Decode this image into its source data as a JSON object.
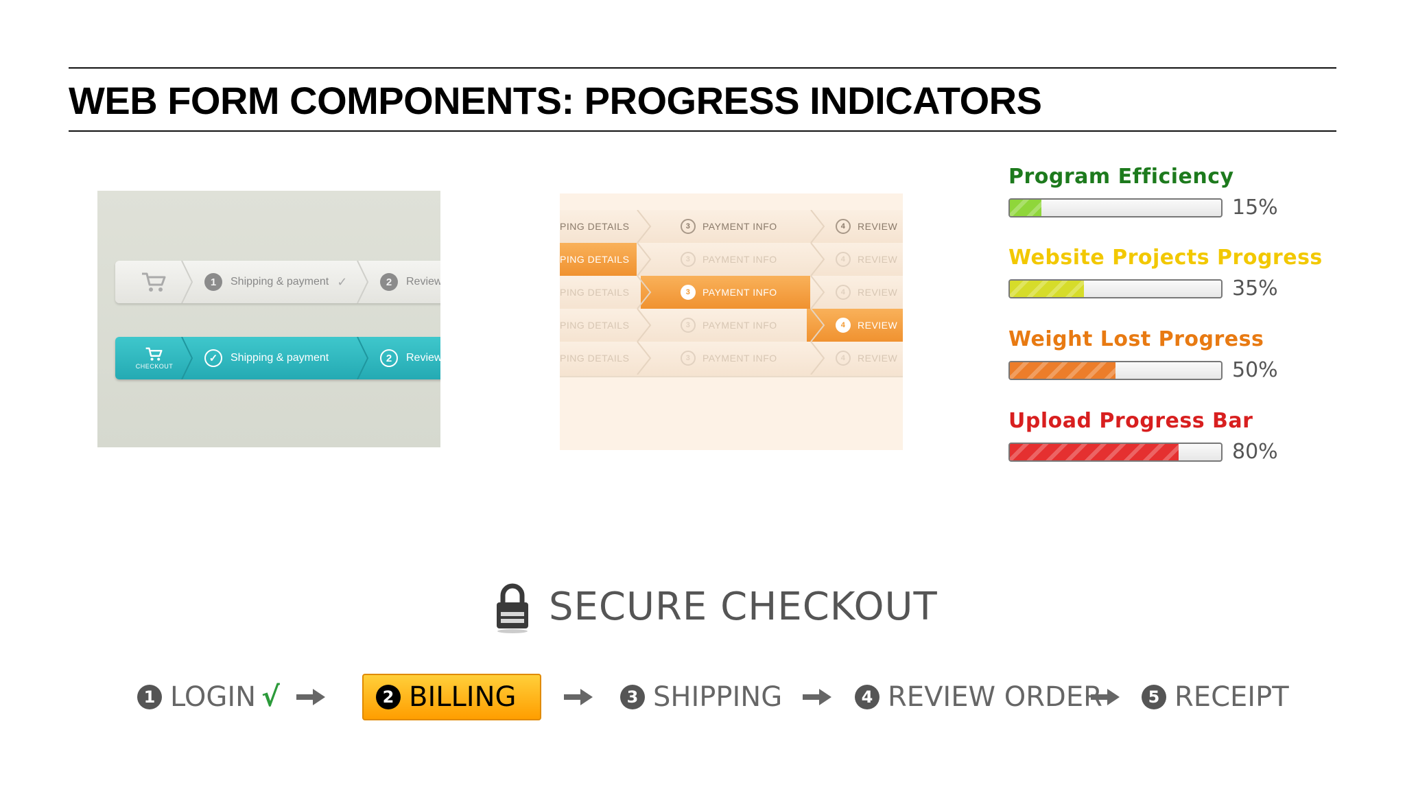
{
  "page": {
    "title": "WEB FORM COMPONENTS: PROGRESS INDICATORS"
  },
  "teal_steps": {
    "checkout_label": "CHECKOUT",
    "step1_number": "1",
    "step1_label": "Shipping & payment",
    "step2_number": "2",
    "step2_label": "Review",
    "check_mark": "✓",
    "icons": [
      "cart-icon",
      "checkmark-icon"
    ],
    "colors": {
      "active": "#2ab3ba",
      "inactive": "#ececE8"
    }
  },
  "orange_steps": {
    "rows": [
      {
        "details": "PING DETAILS",
        "payment_num": "3",
        "payment": "PAYMENT INFO",
        "review_num": "4",
        "review": "REVIEW",
        "active": "none"
      },
      {
        "details": "PING DETAILS",
        "payment_num": "3",
        "payment": "PAYMENT INFO",
        "review_num": "4",
        "review": "REVIEW",
        "active": "details"
      },
      {
        "details": "PING DETAILS",
        "payment_num": "3",
        "payment": "PAYMENT INFO",
        "review_num": "4",
        "review": "REVIEW",
        "active": "payment"
      },
      {
        "details": "PING DETAILS",
        "payment_num": "3",
        "payment": "PAYMENT INFO",
        "review_num": "4",
        "review": "REVIEW",
        "active": "review"
      },
      {
        "details": "PING DETAILS",
        "payment_num": "3",
        "payment": "PAYMENT INFO",
        "review_num": "4",
        "review": "REVIEW",
        "active": "none-faded"
      }
    ],
    "colors": {
      "active": "#f29a33"
    }
  },
  "progress_bars": [
    {
      "title": "Program Efficiency",
      "percent": "15%",
      "value": 0.15,
      "title_color": "#1d7a1d",
      "fill_color": "#8fd63a"
    },
    {
      "title": "Website Projects Progress",
      "percent": "35%",
      "value": 0.35,
      "title_color": "#f2c800",
      "fill_color": "#d6dc2a"
    },
    {
      "title": "Weight Lost Progress",
      "percent": "50%",
      "value": 0.5,
      "title_color": "#e87a12",
      "fill_color": "#ec7d2a"
    },
    {
      "title": "Upload Progress Bar",
      "percent": "80%",
      "value": 0.8,
      "title_color": "#d81f1f",
      "fill_color": "#e53030"
    }
  ],
  "checkout": {
    "title": "SECURE CHECKOUT",
    "lock_icon": "lock-icon",
    "steps": [
      {
        "number": "1",
        "label": "LOGIN",
        "done": true,
        "active": false
      },
      {
        "number": "2",
        "label": "BILLING",
        "done": false,
        "active": true
      },
      {
        "number": "3",
        "label": "SHIPPING",
        "done": false,
        "active": false
      },
      {
        "number": "4",
        "label": "REVIEW ORDER",
        "done": false,
        "active": false
      },
      {
        "number": "5",
        "label": "RECEIPT",
        "done": false,
        "active": false
      }
    ],
    "check_mark": "√",
    "active_color": "#ffb000"
  }
}
